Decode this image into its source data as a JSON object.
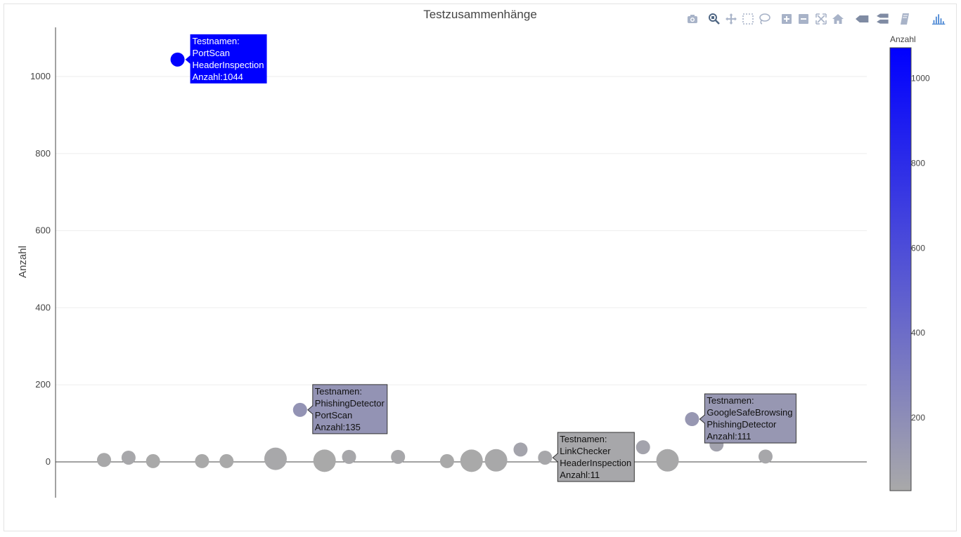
{
  "toolbar": [
    {
      "name": "camera-icon",
      "x": 985
    },
    {
      "name": "zoom-icon",
      "x": 1016
    },
    {
      "name": "pan-icon",
      "x": 1040
    },
    {
      "name": "box-select-icon",
      "x": 1064
    },
    {
      "name": "lasso-select-icon",
      "x": 1088
    },
    {
      "name": "zoom-in-icon",
      "x": 1119
    },
    {
      "name": "zoom-out-icon",
      "x": 1143
    },
    {
      "name": "autoscale-icon",
      "x": 1168
    },
    {
      "name": "home-icon",
      "x": 1192
    },
    {
      "name": "hover-closest-icon",
      "x": 1227
    },
    {
      "name": "hover-compare-icon",
      "x": 1257
    },
    {
      "name": "spike-lines-icon",
      "x": 1288
    },
    {
      "name": "plotly-logo-icon",
      "x": 1336
    }
  ],
  "chart_data": {
    "type": "scatter",
    "title": "Testzusammenhänge",
    "xlabel": "",
    "ylabel": "Anzahl",
    "ylim": [
      -90,
      1120
    ],
    "xlim": [
      -2,
      31
    ],
    "yticks": [
      0,
      200,
      400,
      600,
      800,
      1000
    ],
    "grid": true,
    "colorscale": {
      "title": "Anzahl",
      "min": 0,
      "max": 1044,
      "ticks": [
        200,
        400,
        600,
        800,
        1000
      ],
      "low_color": "#a9a9a9",
      "high_color": "#0000ff"
    },
    "points": [
      {
        "x": 0,
        "y": 5,
        "size": 10
      },
      {
        "x": 1,
        "y": 11,
        "size": 10
      },
      {
        "x": 2,
        "y": 2,
        "size": 10
      },
      {
        "x": 3,
        "y": 1044,
        "size": 10,
        "label": {
          "lines": [
            "Testnamen:",
            "PortScan",
            "HeaderInspection",
            "Anzahl:1044"
          ]
        }
      },
      {
        "x": 4,
        "y": 2,
        "size": 10
      },
      {
        "x": 5,
        "y": 2,
        "size": 10
      },
      {
        "x": 7,
        "y": 8,
        "size": 16
      },
      {
        "x": 8,
        "y": 135,
        "size": 10,
        "label": {
          "lines": [
            "Testnamen:",
            "PhishingDetector",
            "PortScan",
            "Anzahl:135"
          ]
        }
      },
      {
        "x": 9,
        "y": 3,
        "size": 16
      },
      {
        "x": 10,
        "y": 13,
        "size": 10
      },
      {
        "x": 12,
        "y": 13,
        "size": 10
      },
      {
        "x": 14,
        "y": 2,
        "size": 10
      },
      {
        "x": 15,
        "y": 3,
        "size": 16
      },
      {
        "x": 16,
        "y": 4,
        "size": 16
      },
      {
        "x": 17,
        "y": 32,
        "size": 10
      },
      {
        "x": 18,
        "y": 11,
        "size": 10,
        "label": {
          "lines": [
            "Testnamen:",
            "LinkChecker",
            "HeaderInspection",
            "Anzahl:11"
          ]
        }
      },
      {
        "x": 20,
        "y": 6,
        "size": 10
      },
      {
        "x": 21,
        "y": 3,
        "size": 16
      },
      {
        "x": 22,
        "y": 38,
        "size": 10
      },
      {
        "x": 23,
        "y": 4,
        "size": 16
      },
      {
        "x": 24,
        "y": 111,
        "size": 10,
        "label": {
          "lines": [
            "Testnamen:",
            "GoogleSafeBrowsing",
            "PhishingDetector",
            "Anzahl:111"
          ]
        }
      },
      {
        "x": 25,
        "y": 45,
        "size": 10
      },
      {
        "x": 27,
        "y": 14,
        "size": 10
      }
    ]
  }
}
